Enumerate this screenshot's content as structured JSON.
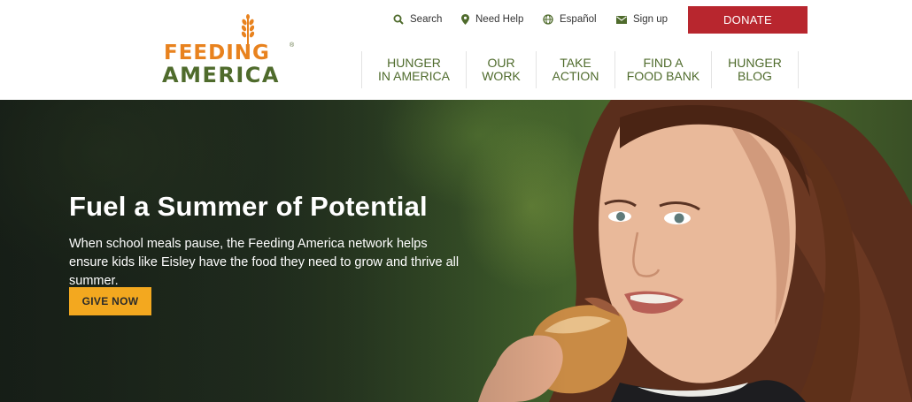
{
  "brand": {
    "logo_line1": "FEEDING",
    "logo_line2": "AMERICA",
    "colors": {
      "orange": "#e8821e",
      "green": "#4f6b2c",
      "red": "#b8262e",
      "gold": "#f3a81f"
    }
  },
  "utility_nav": {
    "search": {
      "label": "Search",
      "icon": "search-icon"
    },
    "help": {
      "label": "Need Help",
      "icon": "location-pin-icon"
    },
    "espanol": {
      "label": "Español",
      "icon": "globe-icon"
    },
    "signup": {
      "label": "Sign up",
      "icon": "envelope-icon"
    }
  },
  "donate_label": "DONATE",
  "main_nav": [
    {
      "line1": "HUNGER",
      "line2": "IN AMERICA"
    },
    {
      "line1": "OUR",
      "line2": "WORK"
    },
    {
      "line1": "TAKE",
      "line2": "ACTION"
    },
    {
      "line1": "FIND A",
      "line2": "FOOD BANK"
    },
    {
      "line1": "HUNGER",
      "line2": "BLOG"
    }
  ],
  "hero": {
    "title": "Fuel a Summer of Potential",
    "body": "When school meals pause, the Feeding America network helps ensure kids like Eisley have the food they need to grow and thrive all summer.",
    "cta": "GIVE NOW"
  }
}
